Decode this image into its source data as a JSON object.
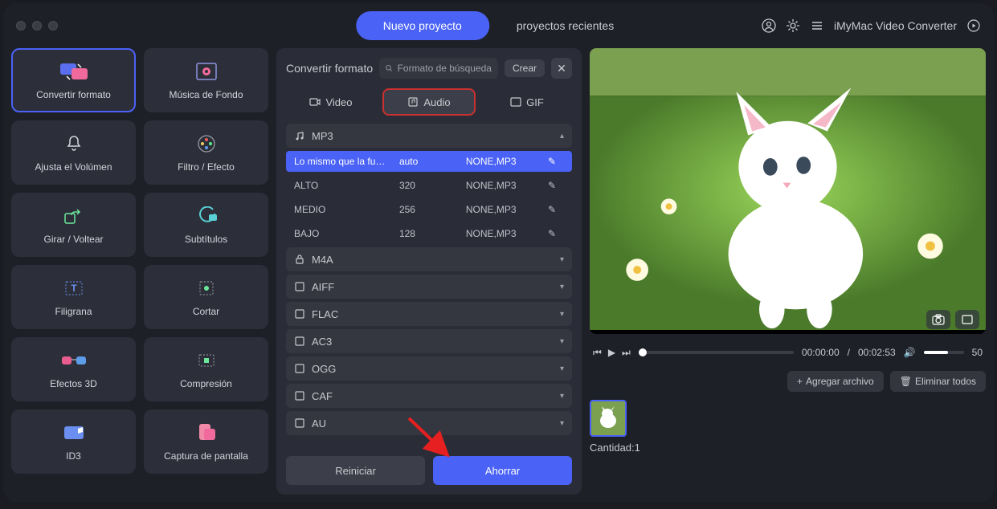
{
  "app_name": "iMyMac Video Converter",
  "top_tabs": {
    "new": "Nuevo proyecto",
    "recent": "proyectos recientes"
  },
  "sidebar": {
    "items": [
      {
        "label": "Convertir formato"
      },
      {
        "label": "Música de Fondo"
      },
      {
        "label": "Ajusta el Volúmen"
      },
      {
        "label": "Filtro / Efecto"
      },
      {
        "label": "Girar / Voltear"
      },
      {
        "label": "Subtítulos"
      },
      {
        "label": "Filigrana"
      },
      {
        "label": "Cortar"
      },
      {
        "label": "Efectos 3D"
      },
      {
        "label": "Compresión"
      },
      {
        "label": "ID3"
      },
      {
        "label": "Captura de pantalla"
      }
    ]
  },
  "mid": {
    "title": "Convertir formato",
    "search_placeholder": "Formato de búsqueda",
    "create_btn": "Crear",
    "type_tabs": {
      "video": "Video",
      "audio": "Audio",
      "gif": "GIF"
    },
    "formats_expanded": {
      "name": "MP3",
      "presets": [
        {
          "name": "Lo mismo que la fu…",
          "rate": "auto",
          "codec": "NONE,MP3"
        },
        {
          "name": "ALTO",
          "rate": "320",
          "codec": "NONE,MP3"
        },
        {
          "name": "MEDIO",
          "rate": "256",
          "codec": "NONE,MP3"
        },
        {
          "name": "BAJO",
          "rate": "128",
          "codec": "NONE,MP3"
        }
      ]
    },
    "formats_collapsed": [
      "M4A",
      "AIFF",
      "FLAC",
      "AC3",
      "OGG",
      "CAF",
      "AU"
    ],
    "reset_btn": "Reiniciar",
    "save_btn": "Ahorrar"
  },
  "player": {
    "time_cur": "00:00:00",
    "time_total": "00:02:53",
    "volume": "50"
  },
  "actions": {
    "add": "Agregar archivo",
    "remove": "Eliminar todos"
  },
  "queue": {
    "qty_label": "Cantidad:",
    "qty_value": "1"
  }
}
